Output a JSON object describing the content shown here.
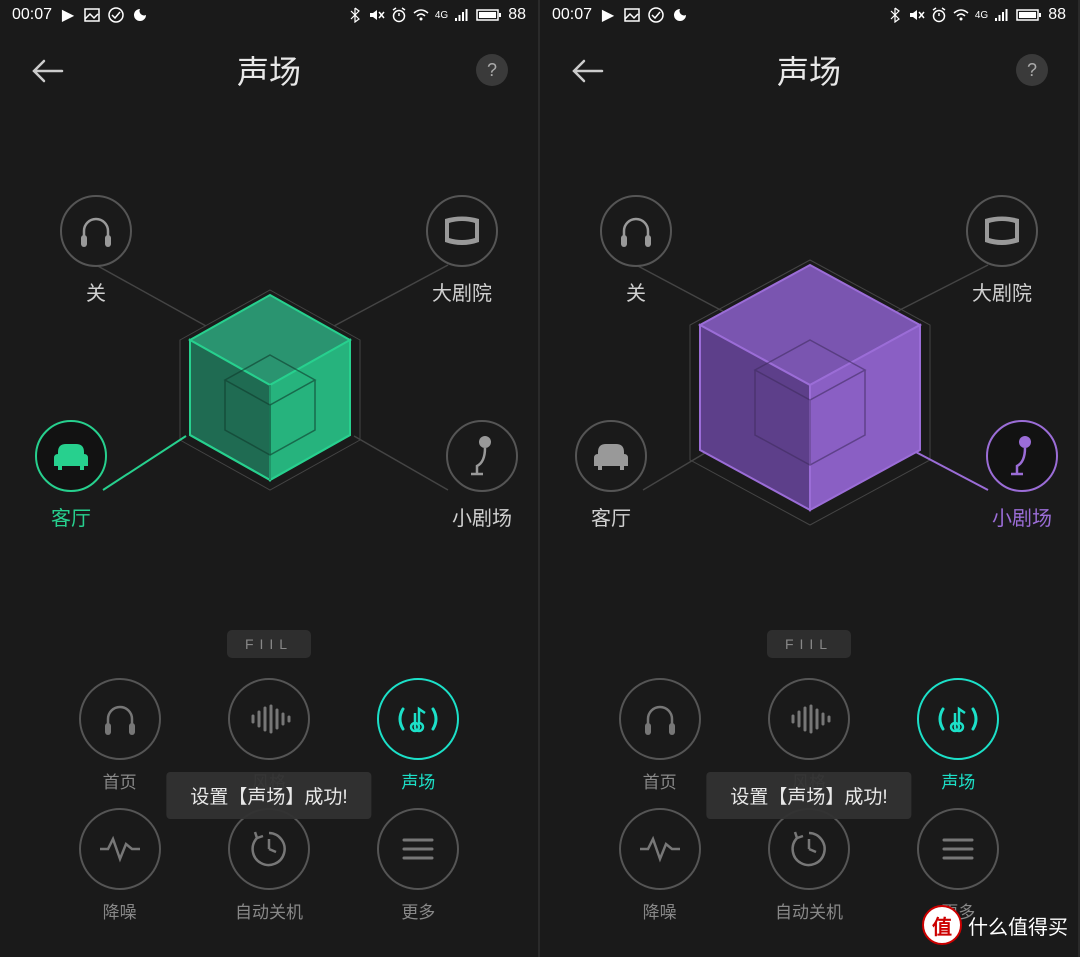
{
  "status": {
    "time": "00:07",
    "battery": "88",
    "network": "4G"
  },
  "header": {
    "title": "声场",
    "help": "?"
  },
  "options": {
    "off": "关",
    "theater": "大剧院",
    "living": "客厅",
    "small": "小剧场"
  },
  "brand": "FIIL",
  "nav": {
    "home": "首页",
    "style": "风格",
    "soundfield": "声场",
    "nc": "降噪",
    "timer": "自动关机",
    "more": "更多"
  },
  "toast": "设置【声场】成功!",
  "accent": {
    "left": "#27d08e",
    "right": "#9b6dd7"
  },
  "active": {
    "left": "living",
    "right": "small"
  },
  "watermark": {
    "badge": "值",
    "text": "什么值得买"
  }
}
